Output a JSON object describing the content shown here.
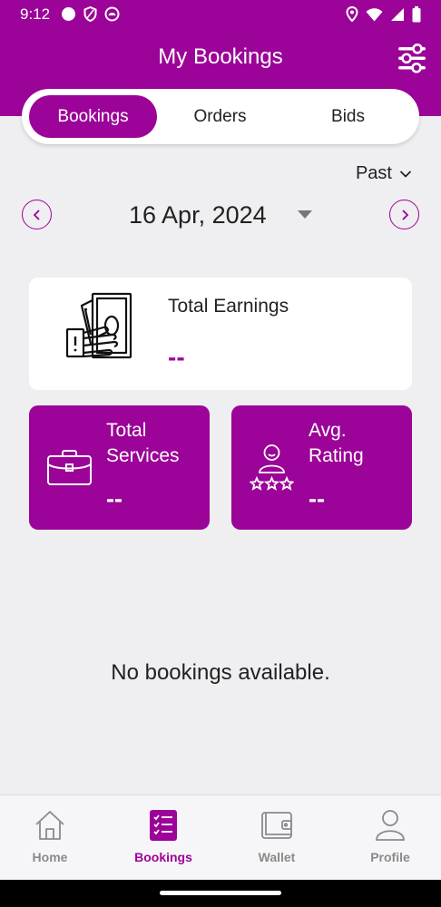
{
  "status_bar": {
    "time": "9:12"
  },
  "header": {
    "title": "My Bookings"
  },
  "tabs": [
    {
      "label": "Bookings",
      "active": true
    },
    {
      "label": "Orders",
      "active": false
    },
    {
      "label": "Bids",
      "active": false
    }
  ],
  "period": {
    "label": "Past"
  },
  "date_nav": {
    "date": "16 Apr, 2024"
  },
  "earnings": {
    "title": "Total Earnings",
    "value": "--"
  },
  "stats": [
    {
      "title_line1": "Total",
      "title_line2": "Services",
      "value": "--",
      "icon": "briefcase-icon"
    },
    {
      "title_line1": "Avg.",
      "title_line2": "Rating",
      "value": "--",
      "icon": "user-rating-icon"
    }
  ],
  "empty_message": "No bookings available.",
  "bottom_nav": [
    {
      "label": "Home",
      "icon": "home-icon",
      "active": false
    },
    {
      "label": "Bookings",
      "icon": "bookings-icon",
      "active": true
    },
    {
      "label": "Wallet",
      "icon": "wallet-icon",
      "active": false
    },
    {
      "label": "Profile",
      "icon": "profile-icon",
      "active": false
    }
  ],
  "colors": {
    "primary": "#9c0398",
    "background": "#efeef0"
  }
}
